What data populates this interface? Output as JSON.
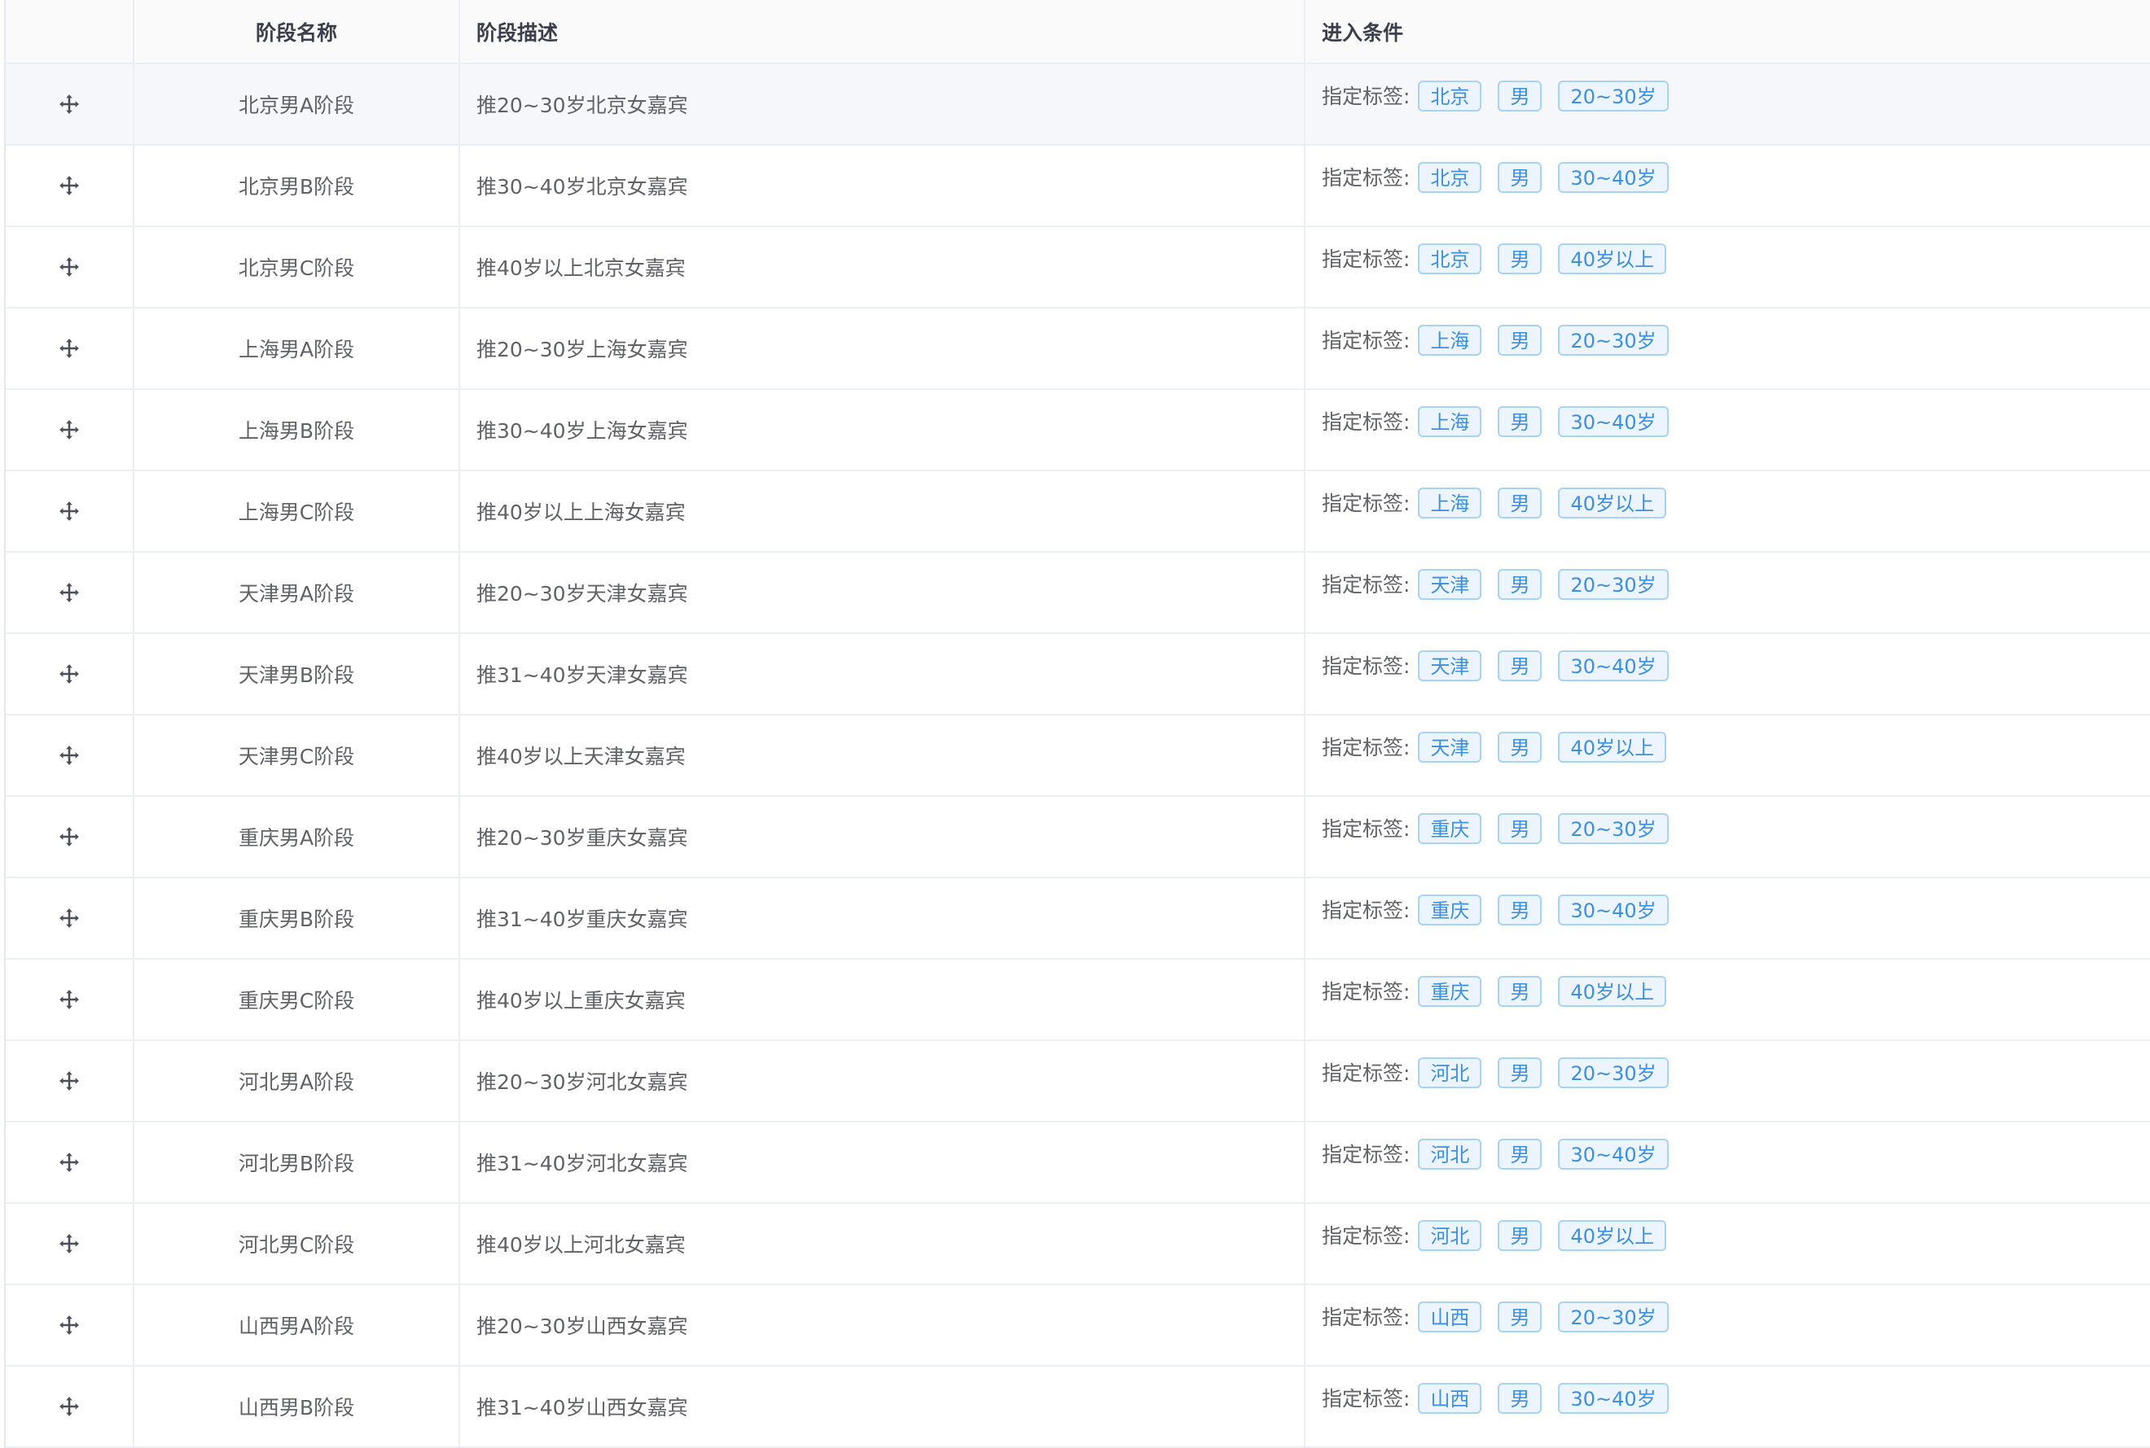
{
  "header": {
    "drag": "",
    "name": "阶段名称",
    "desc": "阶段描述",
    "condition": "进入条件"
  },
  "condition_prefix": "指定标签:",
  "icons": {
    "drag": "move-arrows-icon"
  },
  "colors": {
    "tag_text": "#3d8fe0",
    "tag_border": "#a8d2f6",
    "tag_bg": "#ecf5ff",
    "row_highlight": "#f5f7fa"
  },
  "rows": [
    {
      "name": "北京男A阶段",
      "desc": "推20~30岁北京女嘉宾",
      "tags": [
        "北京",
        "男",
        "20~30岁"
      ]
    },
    {
      "name": "北京男B阶段",
      "desc": "推30~40岁北京女嘉宾",
      "tags": [
        "北京",
        "男",
        "30~40岁"
      ]
    },
    {
      "name": "北京男C阶段",
      "desc": "推40岁以上北京女嘉宾",
      "tags": [
        "北京",
        "男",
        "40岁以上"
      ]
    },
    {
      "name": "上海男A阶段",
      "desc": "推20~30岁上海女嘉宾",
      "tags": [
        "上海",
        "男",
        "20~30岁"
      ]
    },
    {
      "name": "上海男B阶段",
      "desc": "推30~40岁上海女嘉宾",
      "tags": [
        "上海",
        "男",
        "30~40岁"
      ]
    },
    {
      "name": "上海男C阶段",
      "desc": "推40岁以上上海女嘉宾",
      "tags": [
        "上海",
        "男",
        "40岁以上"
      ]
    },
    {
      "name": "天津男A阶段",
      "desc": "推20~30岁天津女嘉宾",
      "tags": [
        "天津",
        "男",
        "20~30岁"
      ]
    },
    {
      "name": "天津男B阶段",
      "desc": "推31~40岁天津女嘉宾",
      "tags": [
        "天津",
        "男",
        "30~40岁"
      ]
    },
    {
      "name": "天津男C阶段",
      "desc": "推40岁以上天津女嘉宾",
      "tags": [
        "天津",
        "男",
        "40岁以上"
      ]
    },
    {
      "name": "重庆男A阶段",
      "desc": "推20~30岁重庆女嘉宾",
      "tags": [
        "重庆",
        "男",
        "20~30岁"
      ]
    },
    {
      "name": "重庆男B阶段",
      "desc": "推31~40岁重庆女嘉宾",
      "tags": [
        "重庆",
        "男",
        "30~40岁"
      ]
    },
    {
      "name": "重庆男C阶段",
      "desc": "推40岁以上重庆女嘉宾",
      "tags": [
        "重庆",
        "男",
        "40岁以上"
      ]
    },
    {
      "name": "河北男A阶段",
      "desc": "推20~30岁河北女嘉宾",
      "tags": [
        "河北",
        "男",
        "20~30岁"
      ]
    },
    {
      "name": "河北男B阶段",
      "desc": "推31~40岁河北女嘉宾",
      "tags": [
        "河北",
        "男",
        "30~40岁"
      ]
    },
    {
      "name": "河北男C阶段",
      "desc": "推40岁以上河北女嘉宾",
      "tags": [
        "河北",
        "男",
        "40岁以上"
      ]
    },
    {
      "name": "山西男A阶段",
      "desc": "推20~30岁山西女嘉宾",
      "tags": [
        "山西",
        "男",
        "20~30岁"
      ]
    },
    {
      "name": "山西男B阶段",
      "desc": "推31~40岁山西女嘉宾",
      "tags": [
        "山西",
        "男",
        "30~40岁"
      ]
    }
  ]
}
